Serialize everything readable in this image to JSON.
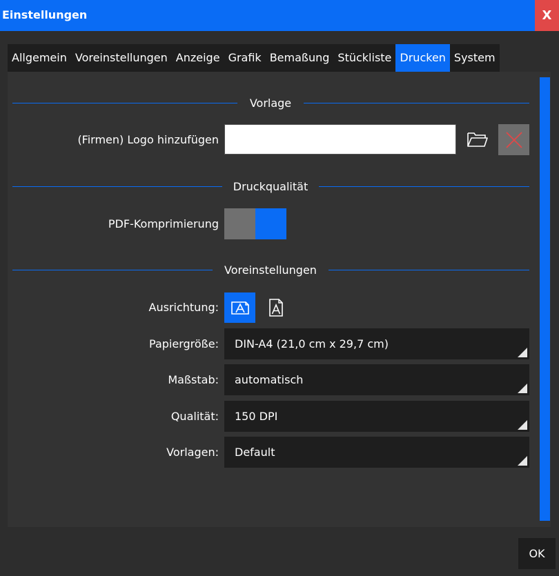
{
  "window": {
    "title": "Einstellungen",
    "close_label": "X"
  },
  "tabs": [
    {
      "label": "Allgemein"
    },
    {
      "label": "Voreinstellungen"
    },
    {
      "label": "Anzeige"
    },
    {
      "label": "Grafik"
    },
    {
      "label": "Bemaßung"
    },
    {
      "label": "Stückliste"
    },
    {
      "label": "Drucken",
      "active": true
    },
    {
      "label": "System"
    }
  ],
  "sections": {
    "vorlage": "Vorlage",
    "druckqualitaet": "Druckqualität",
    "voreinstellungen": "Voreinstellungen"
  },
  "logo": {
    "label": "(Firmen) Logo hinzufügen",
    "value": ""
  },
  "pdf": {
    "label": "PDF-Komprimierung",
    "enabled": true
  },
  "orientation": {
    "label": "Ausrichtung:",
    "selected": "landscape"
  },
  "paper": {
    "label": "Papiergröße:",
    "value": "DIN-A4 (21,0 cm x 29,7 cm)"
  },
  "scale": {
    "label": "Maßstab:",
    "value": "automatisch"
  },
  "quality": {
    "label": "Qualität:",
    "value": "150 DPI"
  },
  "templates": {
    "label": "Vorlagen:",
    "value": "Default"
  },
  "footer": {
    "ok_label": "OK"
  },
  "colors": {
    "accent": "#0a6cf5",
    "close": "#e04848",
    "background": "#2d2d2d",
    "panel": "#333333",
    "field": "#1e1e1e"
  }
}
